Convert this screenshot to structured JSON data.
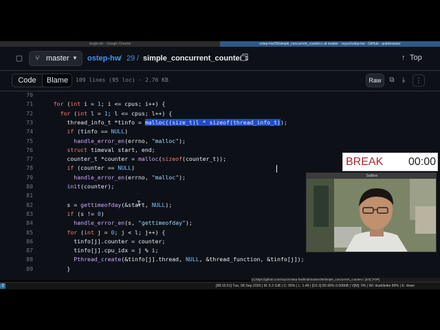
{
  "windows": {
    "left_title": "single.dvi - Google Chrome",
    "right_title": "ostep-hw/29/simple_concurrent_counter.c at master · xxyzz/ostep-hw · GitHub - qutebrowser"
  },
  "header": {
    "branch": "master",
    "repo": "ostep-hw",
    "sep": "/",
    "dir": "29",
    "file": "simple_concurrent_counter.c",
    "top_label": "Top"
  },
  "toolbar": {
    "code_tab": "Code",
    "blame_tab": "Blame",
    "file_meta": "109 lines (95 loc) · 2.76 KB",
    "raw_label": "Raw"
  },
  "code_lines": [
    {
      "ln": "70",
      "text": ""
    },
    {
      "ln": "71",
      "text": "    for (int i = 1; i <= cpus; i++) {"
    },
    {
      "ln": "72",
      "text": "      for (int l = 1; l <= cpus; l++) {"
    },
    {
      "ln": "73",
      "text": "        thread_info_t *tinfo = malloc((size_t)l * sizeof(thread_info_t));"
    },
    {
      "ln": "74",
      "text": "        if (tinfo == NULL)"
    },
    {
      "ln": "75",
      "text": "          handle_error_en(errno, \"malloc\");"
    },
    {
      "ln": "76",
      "text": "        struct timeval start, end;"
    },
    {
      "ln": "77",
      "text": "        counter_t *counter = malloc(sizeof(counter_t));"
    },
    {
      "ln": "78",
      "text": "        if (counter == NULL)"
    },
    {
      "ln": "79",
      "text": "          handle_error_en(errno, \"malloc\");"
    },
    {
      "ln": "80",
      "text": "        init(counter);"
    },
    {
      "ln": "81",
      "text": ""
    },
    {
      "ln": "82",
      "text": "        s = gettimeofday(&start, NULL);"
    },
    {
      "ln": "83",
      "text": "        if (s != 0)"
    },
    {
      "ln": "84",
      "text": "          handle_error_en(s, \"gettimeofday\");"
    },
    {
      "ln": "85",
      "text": "        for (int j = 0; j < l; j++) {"
    },
    {
      "ln": "86",
      "text": "          tinfo[j].counter = counter;"
    },
    {
      "ln": "87",
      "text": "          tinfo[j].cpu_idx = j % i;"
    },
    {
      "ln": "88",
      "text": "          Pthread_create(&tinfo[j].thread, NULL, &thread_function, &tinfo[j]);"
    },
    {
      "ln": "89",
      "text": "        }"
    }
  ],
  "status": {
    "url": "[x] https://github.com/xxyzz/ostep-hw/blob/master/29/simple_concurrent_counter.c [2/4] [TOP]",
    "workspace": "2",
    "system": "[88:16:51] Tue, 08 Sep 2020 | M: 5.2 GiB | C: 05% | L: 1.48 | [D1:3] 85.99% 0.00MiB | V[M]: 0% | Wi: itsahlleike 89% | E: down"
  },
  "overlay": {
    "break_label": "BREAK",
    "break_time": "00:00",
    "cam_title": "Sadbox"
  },
  "colors": {
    "background": "#0d1117",
    "link": "#4493f8",
    "keyword": "#ff7b72",
    "function": "#d2a8ff",
    "number": "#79c0ff",
    "string": "#a5d6ff",
    "selection": "#1f4bcc",
    "break_red": "#b1262b"
  }
}
